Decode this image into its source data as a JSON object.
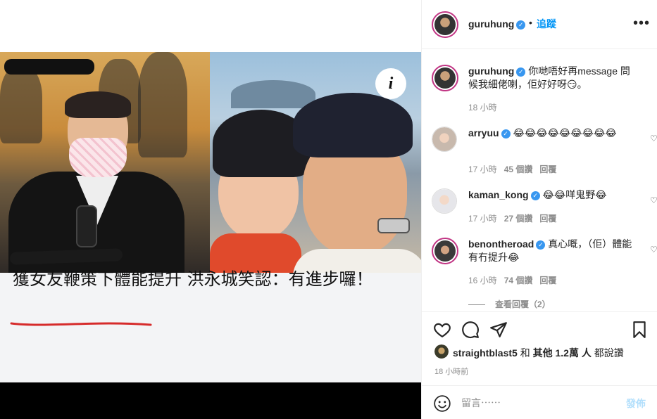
{
  "post": {
    "headline": "獲女友鞭策下體能提升 洪永城笑認：有進步囉！",
    "info_icon": "i"
  },
  "header": {
    "username": "guruhung",
    "verified": "✓",
    "separator": "•",
    "follow_label": "追蹤",
    "more_icon": "•••"
  },
  "comments": [
    {
      "username": "guruhung",
      "text": "你哋唔好再message 問候我細佬喇，佢好好呀😏。",
      "time": "18 小時",
      "likes": "",
      "reply": ""
    },
    {
      "username": "arryuu",
      "text": "😂😂😂😂😂😂😂😂😂",
      "time": "17 小時",
      "likes": "45 個讚",
      "reply": "回覆"
    },
    {
      "username": "kaman_kong",
      "text": "😂😂咩鬼野😂",
      "time": "17 小時",
      "likes": "27 個讚",
      "reply": "回覆"
    },
    {
      "username": "benontheroad",
      "text": "真心嘅，（佢）體能有冇提升😂",
      "time": "16 小時",
      "likes": "74 個讚",
      "reply": "回覆"
    }
  ],
  "view_replies": "查看回覆（2）",
  "likes": {
    "user": "straightblast5",
    "conj": "和",
    "others": "其他 1.2萬 人",
    "suffix": "都說讚"
  },
  "time_ago": "18 小時前",
  "comment_box": {
    "placeholder": "留言⋯⋯",
    "post_label": "發佈"
  },
  "colors": {
    "accent": "#0095f6",
    "verified": "#3897f0",
    "muted": "#8e8e8e"
  }
}
